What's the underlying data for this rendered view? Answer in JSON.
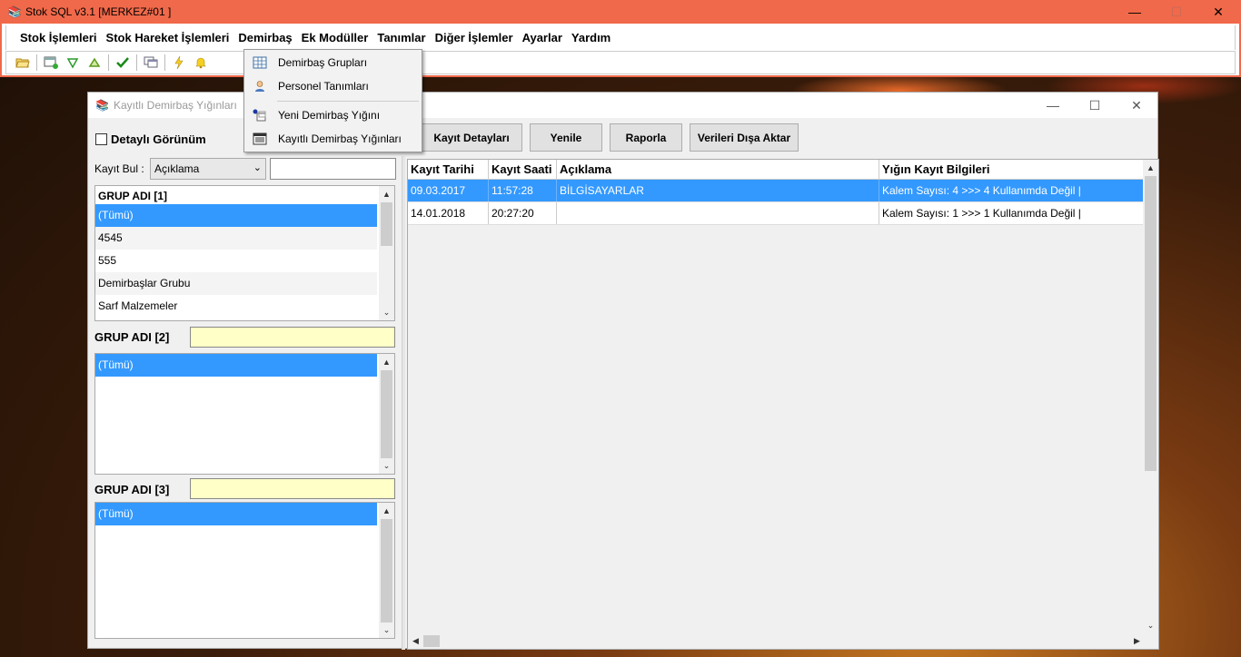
{
  "app": {
    "title": "Stok SQL v3.1  [MERKEZ#01 ]",
    "controls": {
      "minimize": "—",
      "maximize": "☐",
      "close": "✕"
    }
  },
  "menu": {
    "items": [
      "Stok İşlemleri",
      "Stok Hareket İşlemleri",
      "Demirbaş",
      "Ek Modüller",
      "Tanımlar",
      "Diğer İşlemler",
      "Ayarlar",
      "Yardım"
    ]
  },
  "toolbar": {
    "icons": [
      "open-folder-icon",
      "new-record-icon",
      "filter-down-icon",
      "filter-up-icon",
      "check-icon",
      "windows-icon",
      "lightning-icon",
      "bell-icon"
    ]
  },
  "dropdown": {
    "items": [
      {
        "label": "Demirbaş Grupları",
        "icon": "chart-grid-icon"
      },
      {
        "label": "Personel Tanımları",
        "icon": "person-icon"
      },
      {
        "label": "Yeni Demirbaş Yığını",
        "icon": "new-stack-icon"
      },
      {
        "label": "Kayıtlı Demirbaş Yığınları",
        "icon": "list-table-icon"
      }
    ]
  },
  "child": {
    "title": "Kayıtlı Demirbaş Yığınları",
    "controls": {
      "minimize": "—",
      "maximize": "☐",
      "close": "✕"
    },
    "detail_view_label": "Detaylı Görünüm",
    "buttons": {
      "details": "Kayıt Detayları",
      "refresh": "Yenile",
      "report": "Raporla",
      "export": "Verileri Dışa Aktar"
    },
    "find": {
      "label": "Kayıt Bul :",
      "field_value": "Açıklama",
      "search_value": ""
    },
    "group1": {
      "header": "GRUP ADI [1]",
      "items": [
        "(Tümü)",
        "4545",
        "555",
        "Demirbaşlar Grubu",
        "Sarf Malzemeler"
      ]
    },
    "group2": {
      "label": "GRUP ADI [2]",
      "value": "",
      "items": [
        "(Tümü)"
      ]
    },
    "group3": {
      "label": "GRUP ADI [3]",
      "value": "",
      "items": [
        "(Tümü)"
      ]
    },
    "grid": {
      "columns": [
        "Kayıt Tarihi",
        "Kayıt Saati",
        "Açıklama",
        "Yığın Kayıt Bilgileri"
      ],
      "rows": [
        [
          "09.03.2017",
          "11:57:28",
          "BİLGİSAYARLAR",
          "Kalem Sayısı: 4 >>> 4 Kullanımda Değil |"
        ],
        [
          "14.01.2018",
          "20:27:20",
          "",
          "Kalem Sayısı: 1 >>> 1 Kullanımda Değil |"
        ]
      ]
    }
  }
}
